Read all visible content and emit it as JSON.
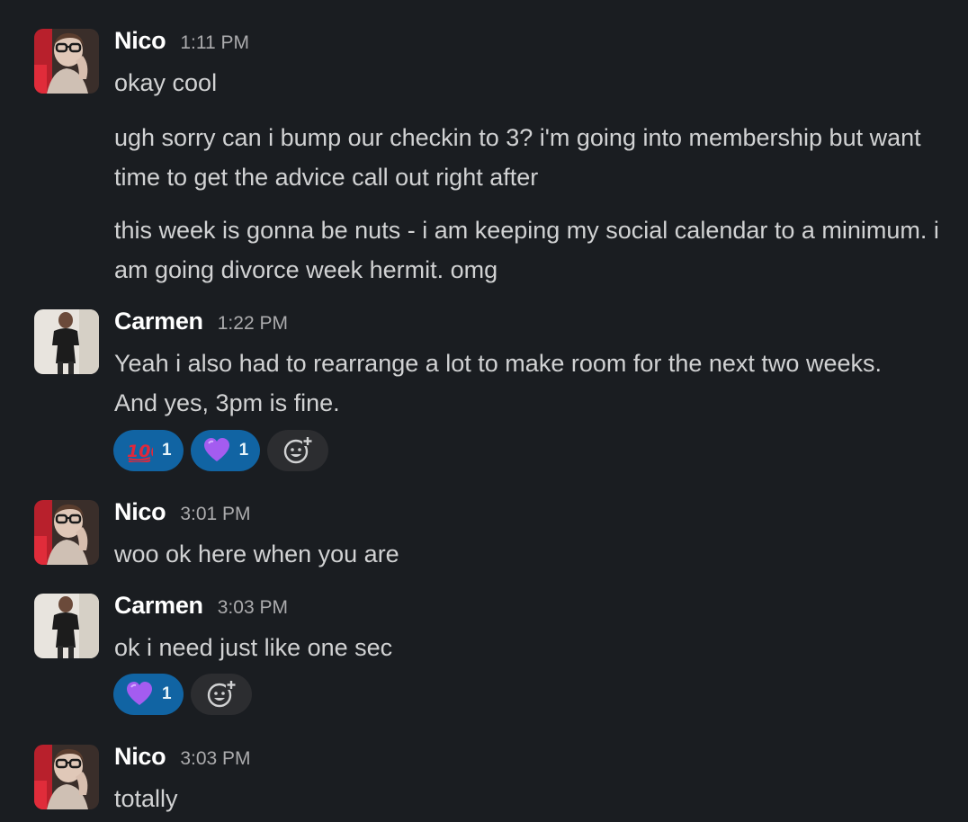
{
  "messages": [
    {
      "user": "Nico",
      "time": "1:11 PM",
      "lines": [
        "okay cool",
        "ugh sorry can i bump our checkin to 3? i'm going into membership but want time to get the advice call out right after",
        "this week is gonna be nuts - i am keeping my social calendar to a minimum. i am going divorce week hermit. omg"
      ]
    },
    {
      "user": "Carmen",
      "time": "1:22 PM",
      "lines": [
        "Yeah i also had to rearrange a lot to make room for the next two weeks. And yes, 3pm is fine."
      ],
      "reactions": [
        {
          "emoji": "hundred-points",
          "count": "1"
        },
        {
          "emoji": "purple-heart",
          "count": "1"
        }
      ]
    },
    {
      "user": "Nico",
      "time": "3:01 PM",
      "lines": [
        "woo ok here when you are"
      ]
    },
    {
      "user": "Carmen",
      "time": "3:03 PM",
      "lines": [
        "ok i need just like one sec"
      ],
      "reactions": [
        {
          "emoji": "purple-heart",
          "count": "1"
        }
      ]
    },
    {
      "user": "Nico",
      "time": "3:03 PM",
      "lines": [
        "totally"
      ]
    }
  ],
  "colors": {
    "background": "#1a1d21",
    "reaction_active": "#1164a3",
    "name": "#ffffff",
    "timestamp": "#ababad"
  }
}
